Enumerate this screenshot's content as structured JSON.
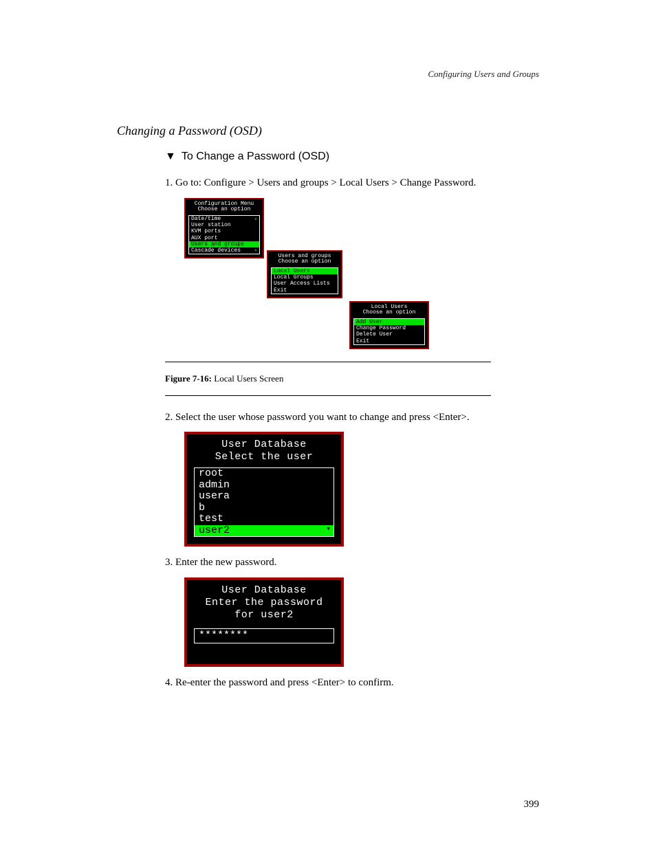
{
  "running_header": "Configuring Users and Groups",
  "section_title": "Changing a Password (OSD)",
  "procedure": {
    "marker": "▼",
    "text": "To Change a Password (OSD)"
  },
  "steps": {
    "s1": "1. Go to: Configure > Users and groups > Local Users > Change Password.",
    "s2": "2. Select the user whose password you want to change and press <Enter>.",
    "s3": "3. Enter the new password.",
    "s4": "4. Re-enter the password and press <Enter> to confirm."
  },
  "osd_config_menu": {
    "title1": "Configuration Menu",
    "title2": "Choose an option",
    "items": [
      "Date/time",
      "User station",
      "KVM ports",
      "AUX port",
      "Users and groups",
      "Cascade devices"
    ],
    "highlight_index": 4
  },
  "osd_users_groups": {
    "title1": "Users and groups",
    "title2": "Choose an option",
    "items": [
      "Local Users",
      "Local Groups",
      "User Access Lists",
      "Exit"
    ],
    "highlight_index": 0
  },
  "osd_local_users": {
    "title1": "Local Users",
    "title2": "Choose an option",
    "items": [
      "Add User",
      "Change Password",
      "Delete User",
      "Exit"
    ],
    "highlight_index": 0
  },
  "figure_caption": {
    "label": "Figure 7-16:",
    "text": "Local Users Screen"
  },
  "osd_user_db": {
    "title1": "User Database",
    "title2": "Select the user",
    "items": [
      "root",
      "admin",
      "usera",
      "b",
      "test",
      "user2"
    ],
    "highlight_index": 5
  },
  "osd_password": {
    "title1": "User Database",
    "title2": "Enter the password",
    "title3": "for user2",
    "value": "********"
  },
  "page_number": "399"
}
